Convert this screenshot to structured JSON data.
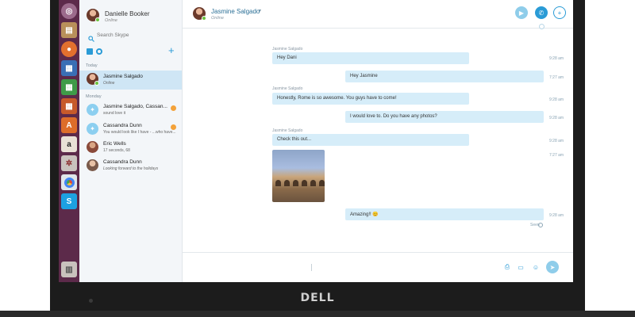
{
  "device": {
    "brand": "DELL"
  },
  "launcher": {
    "apps": [
      {
        "name": "ubuntu-dash-icon",
        "color": "#9c6b8c"
      },
      {
        "name": "files-icon",
        "color": "#b9905a"
      },
      {
        "name": "firefox-icon",
        "color": "#e2702e"
      },
      {
        "name": "writer-icon",
        "color": "#3a6fb5"
      },
      {
        "name": "calc-icon",
        "color": "#3f9b48"
      },
      {
        "name": "impress-icon",
        "color": "#c75a2a"
      },
      {
        "name": "software-center-icon",
        "color": "#dd6d2a"
      },
      {
        "name": "amazon-icon",
        "color": "#e9e1d6"
      },
      {
        "name": "settings-icon",
        "color": "#c9c2bd"
      },
      {
        "name": "chrome-icon",
        "color": "#dfe6ea"
      },
      {
        "name": "skype-icon",
        "color": "#1da1e1"
      },
      {
        "name": "trash-icon",
        "color": "#c9c2bd"
      }
    ]
  },
  "profile": {
    "name": "Danielle Booker",
    "status": "Online"
  },
  "search": {
    "placeholder": "Search Skype"
  },
  "sections": {
    "today": "Today",
    "monday": "Monday"
  },
  "conversations": [
    {
      "name": "Jasmine Salgado",
      "preview": "Online",
      "selected": true
    },
    {
      "name": "Jasmine Salgado, Cassan...",
      "preview": "sound love it",
      "unread": true
    },
    {
      "name": "Cassandra Dunn",
      "preview": "You would look like I have - ...who have...",
      "unread": true
    },
    {
      "name": "Eric Wells",
      "preview": "17 seconds, 68"
    },
    {
      "name": "Cassandra Dunn",
      "preview": "Looking forward to the holidays"
    }
  ],
  "chat": {
    "contact": "Jasmine Salgado",
    "status": "Online",
    "messages": [
      {
        "sender": "Jasmine Salgado",
        "text": "Hey Dani",
        "time": "9:28 am"
      },
      {
        "sender": "",
        "text": "Hey Jasmine",
        "time": "7:27 am"
      },
      {
        "sender": "Jasmine Salgado",
        "text": "Honestly, Rome is so awesome. You guys have to come!",
        "time": "9:28 am"
      },
      {
        "sender": "",
        "text": "I would love to. Do you have any photos?",
        "time": "9:28 am"
      },
      {
        "sender": "Jasmine Salgado",
        "text": "Check this out...",
        "time": "9:28 am",
        "extra_time": "7:27 am"
      },
      {
        "sender": "",
        "text": "Amazing!! 😊",
        "time": "9:28 am"
      }
    ],
    "seen_label": "Seen"
  },
  "colors": {
    "accent": "#2a9bd6",
    "bubble": "#d6edf9",
    "launcher": "#5c2a4a",
    "online": "#6ac23f",
    "unread": "#f3a23a"
  }
}
